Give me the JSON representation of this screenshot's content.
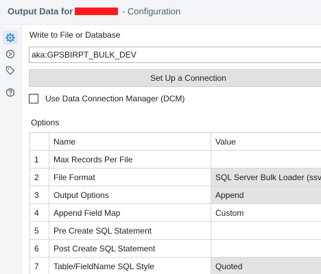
{
  "header": {
    "title_prefix": "Output Data for",
    "title_suffix": " - Configuration"
  },
  "sidebar": {
    "items": [
      {
        "icon": "gear-icon"
      },
      {
        "icon": "output-anchor-icon"
      },
      {
        "icon": "tag-icon"
      },
      {
        "icon": "help-icon"
      }
    ]
  },
  "write_label": "Write to File or Database",
  "path_value": "aka:GPSBIRPT_BULK_DEV",
  "setup_button": "Set Up a Connection",
  "dcm_checkbox": {
    "label": "Use Data Connection Manager (DCM)",
    "checked": false
  },
  "options_label": "Options",
  "options_table": {
    "headers": [
      "Name",
      "Value"
    ],
    "rows": [
      {
        "num": "1",
        "name": "Max Records Per File",
        "value": ""
      },
      {
        "num": "2",
        "name": "File Format",
        "value": "SQL Server Bulk Loader (ssvb:)"
      },
      {
        "num": "3",
        "name": "Output Options",
        "value": "Append"
      },
      {
        "num": "4",
        "name": "Append Field Map",
        "value": "Custom"
      },
      {
        "num": "5",
        "name": "Pre Create SQL Statement",
        "value": ""
      },
      {
        "num": "6",
        "name": "Post Create SQL Statement",
        "value": ""
      },
      {
        "num": "7",
        "name": "Table/FieldName SQL Style",
        "value": "Quoted"
      }
    ]
  },
  "colors": {
    "title": "#4e6474",
    "redaction": "#ff1a1a",
    "active_icon": "#2e86c9",
    "dropdown_cell": "#e3e3e3"
  }
}
